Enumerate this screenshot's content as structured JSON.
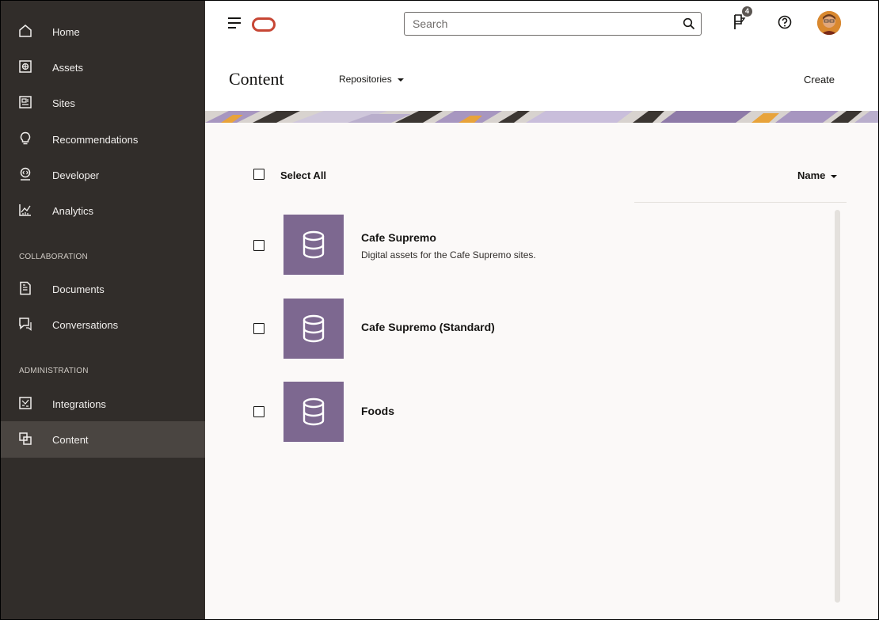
{
  "sidebar": {
    "items": [
      {
        "label": "Home",
        "icon": "home-icon"
      },
      {
        "label": "Assets",
        "icon": "assets-icon"
      },
      {
        "label": "Sites",
        "icon": "sites-icon"
      },
      {
        "label": "Recommendations",
        "icon": "lightbulb-icon"
      },
      {
        "label": "Developer",
        "icon": "developer-icon"
      },
      {
        "label": "Analytics",
        "icon": "analytics-icon"
      }
    ],
    "collaboration_label": "COLLABORATION",
    "collaboration": [
      {
        "label": "Documents",
        "icon": "documents-icon"
      },
      {
        "label": "Conversations",
        "icon": "conversations-icon"
      }
    ],
    "administration_label": "ADMINISTRATION",
    "administration": [
      {
        "label": "Integrations",
        "icon": "integrations-icon"
      },
      {
        "label": "Content",
        "icon": "content-icon",
        "active": true
      }
    ]
  },
  "topbar": {
    "search_placeholder": "Search",
    "notification_count": "4"
  },
  "header": {
    "title": "Content",
    "repositories_label": "Repositories",
    "create_label": "Create"
  },
  "list": {
    "select_all_label": "Select All",
    "sort_label": "Name",
    "repositories": [
      {
        "name": "Cafe Supremo",
        "description": "Digital assets for the Cafe Supremo sites."
      },
      {
        "name": "Cafe Supremo (Standard)",
        "description": ""
      },
      {
        "name": "Foods",
        "description": ""
      }
    ]
  },
  "colors": {
    "sidebar_bg": "#312d2a",
    "active_item_bg": "#4a4541",
    "repo_tile": "#7d6890",
    "oracle_red": "#c74634"
  }
}
